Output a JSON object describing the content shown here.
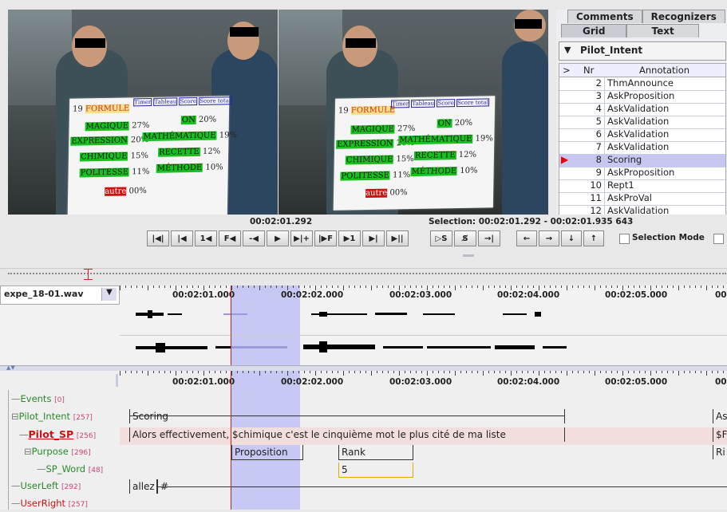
{
  "tabs_top": [
    "Comments",
    "Recognizers"
  ],
  "tabs_second": [
    "Grid",
    "Text"
  ],
  "grid": {
    "tier": "Pilot_Intent",
    "col_nr": "Nr",
    "col_annotation": "Annotation",
    "rows": [
      {
        "nr": "2",
        "annotation": "ThmAnnounce"
      },
      {
        "nr": "3",
        "annotation": "AskProposition"
      },
      {
        "nr": "4",
        "annotation": "AskValidation"
      },
      {
        "nr": "5",
        "annotation": "AskValidation"
      },
      {
        "nr": "6",
        "annotation": "AskValidation"
      },
      {
        "nr": "7",
        "annotation": "AskValidation"
      },
      {
        "nr": "8",
        "annotation": "Scoring"
      },
      {
        "nr": "9",
        "annotation": "AskProposition"
      },
      {
        "nr": "10",
        "annotation": "Rept1"
      },
      {
        "nr": "11",
        "annotation": "AskProVal"
      },
      {
        "nr": "12",
        "annotation": "AskValidation"
      }
    ],
    "selected_nr": "8"
  },
  "slide": {
    "title_num": "19",
    "title_word": "FORMULE",
    "head_cells": [
      "Timer",
      "Tableau",
      "Score",
      "Score total"
    ],
    "rows": [
      {
        "left": "MAGIQUE",
        "lpct": "27%",
        "right": "ON",
        "rpct": "20%"
      },
      {
        "left": "EXPRESSION",
        "lpct": "20%",
        "right": "MATHÉMATIQUE",
        "rpct": "19%"
      },
      {
        "left": "CHIMIQUE",
        "lpct": "15%",
        "right": "RECETTE",
        "rpct": "12%"
      },
      {
        "left": "POLITESSE",
        "lpct": "11%",
        "right": "MÉTHODE",
        "rpct": "10%"
      }
    ],
    "other_label": "autre",
    "other_pct": "00%"
  },
  "player": {
    "current_time": "00:02:01.292",
    "selection_label": "Selection: 00:02:01.292 - 00:02:01.935  643",
    "buttons": [
      "|◀|",
      "|◀",
      "1◀",
      "F◀",
      "-◀",
      "▶",
      "▶|+",
      "|▶F",
      "▶1",
      "▶|",
      "▶||"
    ],
    "sel_buttons": [
      "▷S",
      "S̸",
      "→|"
    ],
    "arrow_buttons": [
      "←",
      "→",
      "↓",
      "↑"
    ],
    "selection_mode": "Selection Mode"
  },
  "waveform": {
    "file": "expe_18-01.wav",
    "times": [
      "00:02:01.000",
      "00:02:02.000",
      "00:02:03.000",
      "00:02:04.000",
      "00:02:05.000",
      "00:"
    ]
  },
  "tiers": [
    {
      "name": "Events",
      "count": "[0]",
      "color": "#2a8a2a"
    },
    {
      "name": "Pilot_Intent",
      "count": "[257]",
      "color": "#2a8a2a"
    },
    {
      "name": "Pilot_SP",
      "count": "[256]",
      "color": "#d01010"
    },
    {
      "name": "Purpose",
      "count": "[296]",
      "color": "#2a8a2a"
    },
    {
      "name": "SP_Word",
      "count": "[48]",
      "color": "#2a8a2a"
    },
    {
      "name": "UserLeft",
      "count": "[292]",
      "color": "#2a8a2a"
    },
    {
      "name": "UserRight",
      "count": "[257]",
      "color": "#d01010"
    }
  ],
  "annotations": {
    "pilot_intent": "Scoring",
    "pilot_intent_right": "As",
    "pilot_sp": "Alors effectivement, $chimique c'est le cinquième mot le plus cité de ma liste",
    "pilot_sp_right": "$F",
    "purpose_a": "Proposition",
    "purpose_b": "Rank",
    "purpose_right": "Ri",
    "sp_word": "5",
    "userleft_a": "allez",
    "userleft_b": "#"
  },
  "colors": {
    "selection": "#c8c8f4",
    "crosshair": "#d02020",
    "selected_row": "#c7c7f0"
  }
}
